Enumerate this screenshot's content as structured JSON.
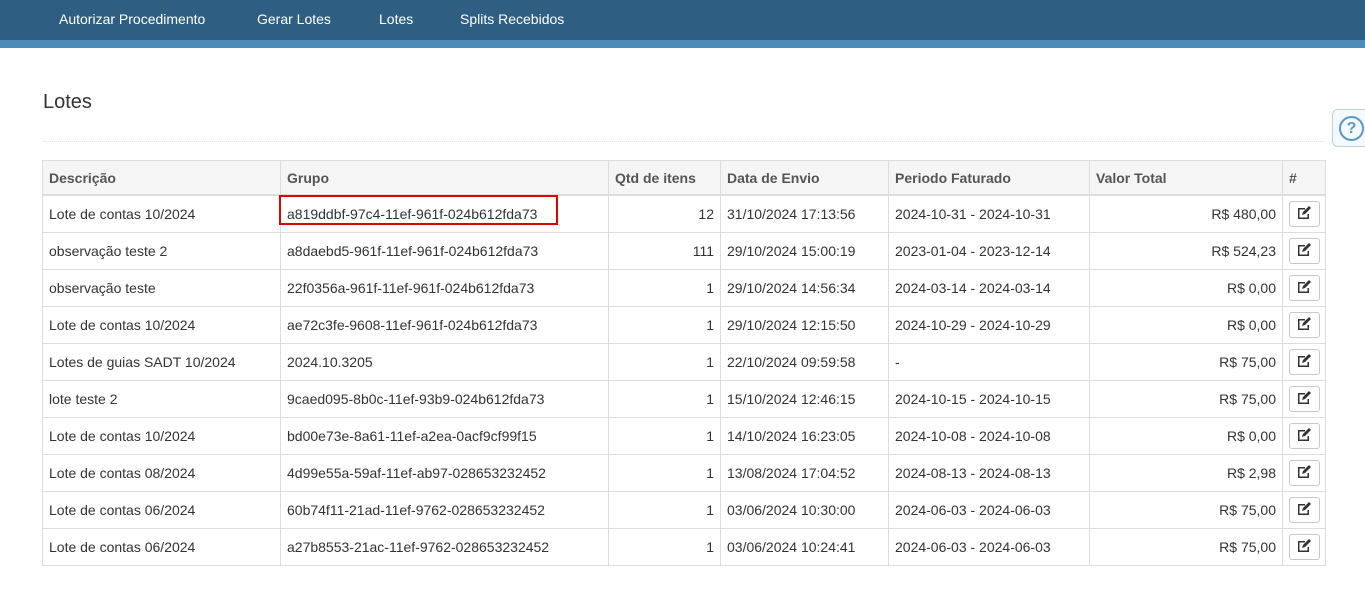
{
  "nav": {
    "items": [
      {
        "label": "Autorizar Procedimento"
      },
      {
        "label": "Gerar Lotes"
      },
      {
        "label": "Lotes"
      },
      {
        "label": "Splits Recebidos"
      }
    ]
  },
  "page": {
    "title": "Lotes",
    "help_icon": "?"
  },
  "table": {
    "headers": [
      "Descrição",
      "Grupo",
      "Qtd de itens",
      "Data de Envio",
      "Periodo Faturado",
      "Valor Total",
      "#"
    ],
    "rows": [
      [
        "Lote de contas 10/2024",
        "a819ddbf-97c4-11ef-961f-024b612fda73",
        "12",
        "31/10/2024 17:13:56",
        "2024-10-31 - 2024-10-31",
        "R$ 480,00"
      ],
      [
        "observação teste 2",
        "a8daebd5-961f-11ef-961f-024b612fda73",
        "111",
        "29/10/2024 15:00:19",
        "2023-01-04 - 2023-12-14",
        "R$ 524,23"
      ],
      [
        "observação teste",
        "22f0356a-961f-11ef-961f-024b612fda73",
        "1",
        "29/10/2024 14:56:34",
        "2024-03-14 - 2024-03-14",
        "R$ 0,00"
      ],
      [
        "Lote de contas 10/2024",
        "ae72c3fe-9608-11ef-961f-024b612fda73",
        "1",
        "29/10/2024 12:15:50",
        "2024-10-29 - 2024-10-29",
        "R$ 0,00"
      ],
      [
        "Lotes de guias SADT 10/2024",
        "2024.10.3205",
        "1",
        "22/10/2024 09:59:58",
        "-",
        "R$ 75,00"
      ],
      [
        "lote teste 2",
        "9caed095-8b0c-11ef-93b9-024b612fda73",
        "1",
        "15/10/2024 12:46:15",
        "2024-10-15 - 2024-10-15",
        "R$ 75,00"
      ],
      [
        "Lote de contas 10/2024",
        "bd00e73e-8a61-11ef-a2ea-0acf9cf99f15",
        "1",
        "14/10/2024 16:23:05",
        "2024-10-08 - 2024-10-08",
        "R$ 0,00"
      ],
      [
        "Lote de contas 08/2024",
        "4d99e55a-59af-11ef-ab97-028653232452",
        "1",
        "13/08/2024 17:04:52",
        "2024-08-13 - 2024-08-13",
        "R$ 2,98"
      ],
      [
        "Lote de contas 06/2024",
        "60b74f11-21ad-11ef-9762-028653232452",
        "1",
        "03/06/2024 10:30:00",
        "2024-06-03 - 2024-06-03",
        "R$ 75,00"
      ],
      [
        "Lote de contas 06/2024",
        "a27b8553-21ac-11ef-9762-028653232452",
        "1",
        "03/06/2024 10:24:41",
        "2024-06-03 - 2024-06-03",
        "R$ 75,00"
      ]
    ],
    "row_action_icon": "edit-icon"
  },
  "colors": {
    "nav_bg": "#2e5f83",
    "nav_accent": "#4b8cb8",
    "highlight": "#e00000"
  }
}
